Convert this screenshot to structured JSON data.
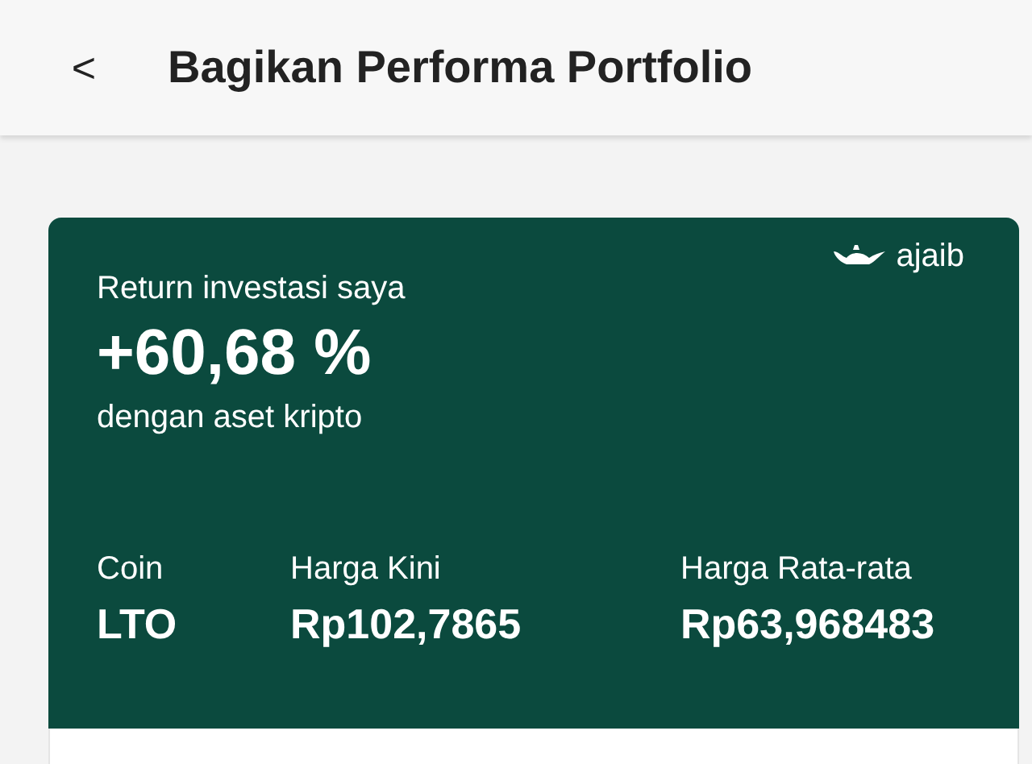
{
  "header": {
    "back": "<",
    "title": "Bagikan Performa Portfolio"
  },
  "card": {
    "brand": "ajaib",
    "label": "Return investasi saya",
    "return": "+60,68 %",
    "subtitle": "dengan aset kripto",
    "stats": [
      {
        "label": "Coin",
        "value": "LTO"
      },
      {
        "label": "Harga Kini",
        "value": "Rp102,7865"
      },
      {
        "label": "Harga Rata-rata",
        "value": "Rp63,968483"
      }
    ]
  }
}
